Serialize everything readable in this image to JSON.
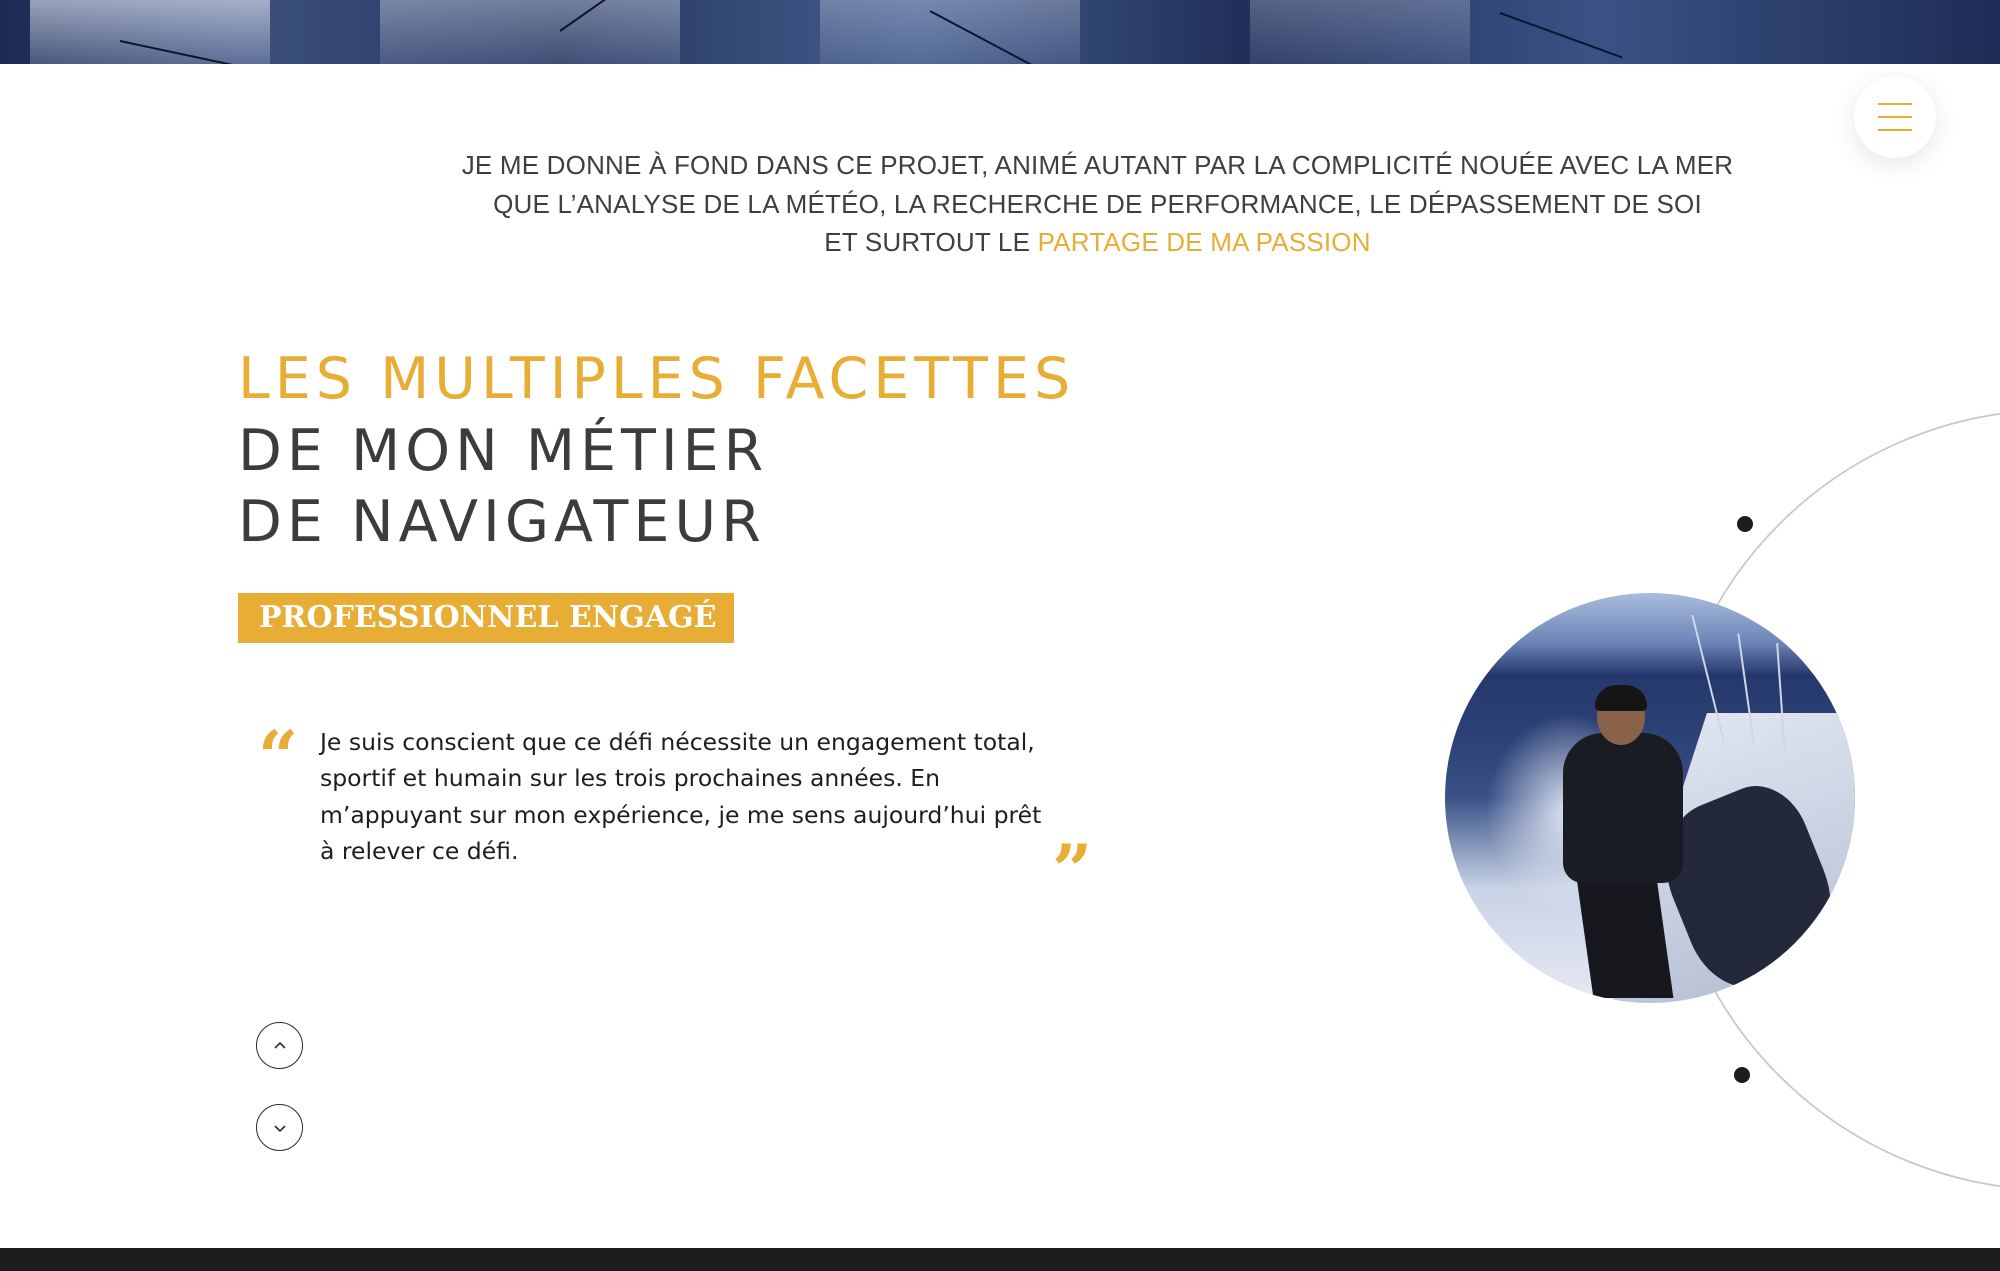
{
  "menu": {
    "icon": "hamburger-menu-icon"
  },
  "intro": {
    "line1": "JE ME DONNE À FOND DANS CE PROJET, ANIMÉ AUTANT PAR LA COMPLICITÉ NOUÉE AVEC LA MER",
    "line2": "QUE L’ANALYSE DE LA MÉTÉO, LA RECHERCHE DE PERFORMANCE, LE DÉPASSEMENT DE SOI",
    "line3_prefix": "ET SURTOUT LE ",
    "line3_highlight": "PARTAGE DE MA PASSION"
  },
  "section": {
    "heading_line1": "LES MULTIPLES FACETTES",
    "heading_line2": "DE MON MÉTIER",
    "heading_line3": "DE NAVIGATEUR",
    "badge": "PROFESSIONNEL ENGAGÉ",
    "quote_open": "“",
    "quote_close": "”",
    "quote": "Je suis conscient que ce défi nécessite un engagement total, sportif et humain sur les trois prochaines années. En m’appuyant sur mon expérience, je me sens aujourd’hui prêt à relever ce défi."
  },
  "navigation": {
    "up_icon": "chevron-up-icon",
    "down_icon": "chevron-down-icon"
  },
  "colors": {
    "accent": "#e8ad35",
    "text_dark": "#3c3c40",
    "footer": "#1d1d1f"
  }
}
